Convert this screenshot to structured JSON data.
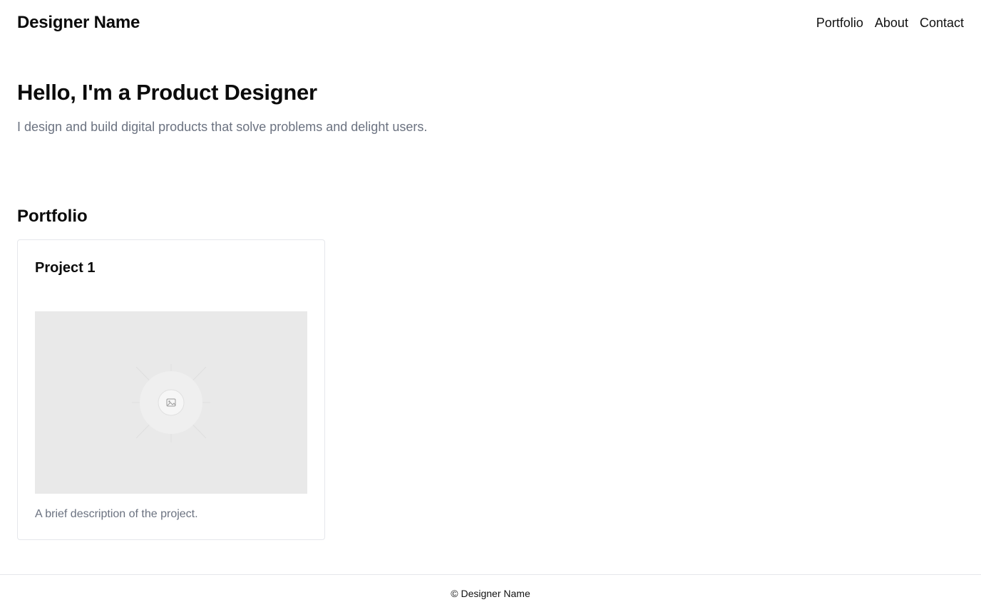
{
  "header": {
    "site_name": "Designer Name",
    "nav": [
      {
        "label": "Portfolio"
      },
      {
        "label": "About"
      },
      {
        "label": "Contact"
      }
    ]
  },
  "hero": {
    "title": "Hello, I'm a Product Designer",
    "subtitle": "I design and build digital products that solve problems and delight users."
  },
  "portfolio": {
    "section_title": "Portfolio",
    "projects": [
      {
        "title": "Project 1",
        "image_icon": "image-placeholder-icon",
        "description": "A brief description of the project."
      }
    ]
  },
  "footer": {
    "text": "© Designer Name"
  },
  "colors": {
    "text": "#0b0b0b",
    "muted": "#6b7280",
    "border": "#e5e7eb",
    "placeholder_bg": "#e9e9e9"
  }
}
